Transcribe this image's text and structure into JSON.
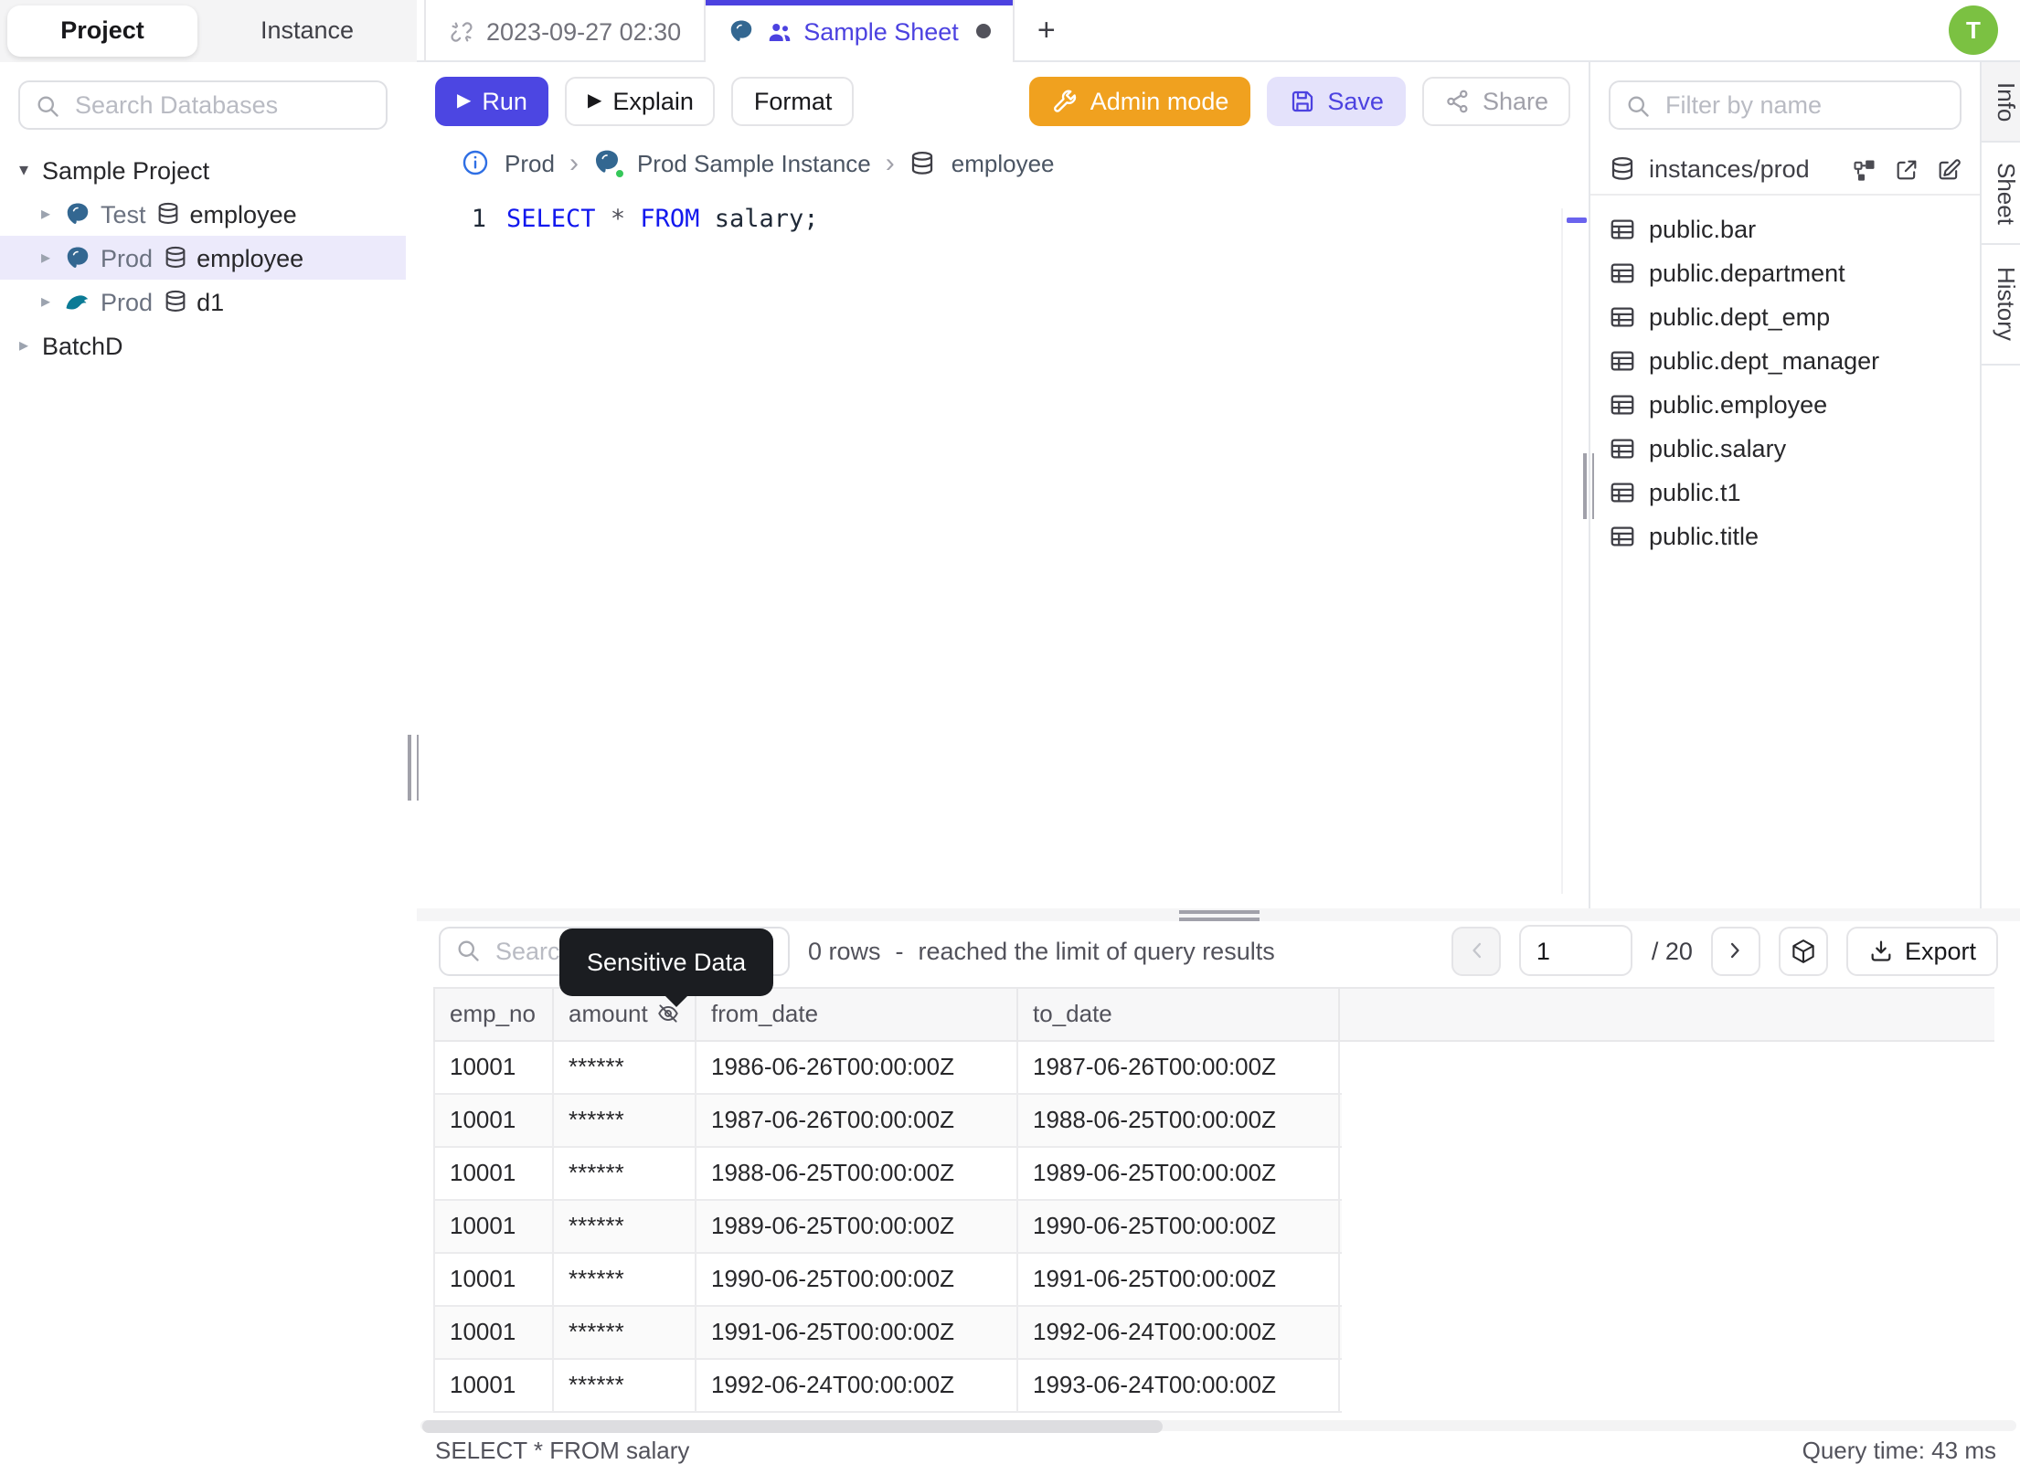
{
  "colors": {
    "accent": "#4c42e0",
    "admin_orange": "#f0a11f",
    "save_bg": "#e4e2fb",
    "avatar_green": "#7bc142",
    "keyword_blue": "#1218ee",
    "selected_tree_bg": "#eceafb",
    "tooltip_bg": "#1b1d21"
  },
  "topbar": {
    "project_tab": "Project",
    "instance_tab": "Instance",
    "editor_tabs": [
      {
        "label": "2023-09-27 02:30"
      },
      {
        "label": "Sample Sheet"
      }
    ],
    "new_tab_label": "+",
    "avatar_initial": "T"
  },
  "sidebar": {
    "search_placeholder": "Search Databases",
    "tree": [
      {
        "label": "Sample Project"
      },
      {
        "env": "Test",
        "db": "employee"
      },
      {
        "env": "Prod",
        "db": "employee"
      },
      {
        "env": "Prod",
        "db": "d1"
      },
      {
        "label": "BatchD"
      }
    ]
  },
  "toolbar": {
    "run": "Run",
    "explain": "Explain",
    "format": "Format",
    "admin_mode": "Admin mode",
    "save": "Save",
    "share": "Share"
  },
  "breadcrumb": {
    "env": "Prod",
    "instance": "Prod Sample Instance",
    "database": "employee"
  },
  "editor": {
    "line_number": "1",
    "sql": {
      "kw1": "SELECT",
      "star": "*",
      "kw2": "FROM",
      "rest": " salary;"
    }
  },
  "right_panel": {
    "filter_placeholder": "Filter by name",
    "header": "instances/prod",
    "tables": [
      "public.bar",
      "public.department",
      "public.dept_emp",
      "public.dept_manager",
      "public.employee",
      "public.salary",
      "public.t1",
      "public.title"
    ]
  },
  "side_tabs": {
    "info": "Info",
    "sheet": "Sheet",
    "history": "History"
  },
  "results": {
    "search_placeholder": "Search",
    "tooltip": "Sensitive Data",
    "row_count_fragment": "0 rows",
    "dash": "-",
    "limit_note": "reached the limit of query results",
    "page": {
      "current": "1",
      "total": "/ 20"
    },
    "export_label": "Export",
    "table": {
      "columns": [
        "emp_no",
        "amount",
        "from_date",
        "to_date"
      ],
      "masked_column": "amount",
      "rows": [
        {
          "emp_no": "10001",
          "amount": "******",
          "from_date": "1986-06-26T00:00:00Z",
          "to_date": "1987-06-26T00:00:00Z"
        },
        {
          "emp_no": "10001",
          "amount": "******",
          "from_date": "1987-06-26T00:00:00Z",
          "to_date": "1988-06-25T00:00:00Z"
        },
        {
          "emp_no": "10001",
          "amount": "******",
          "from_date": "1988-06-25T00:00:00Z",
          "to_date": "1989-06-25T00:00:00Z"
        },
        {
          "emp_no": "10001",
          "amount": "******",
          "from_date": "1989-06-25T00:00:00Z",
          "to_date": "1990-06-25T00:00:00Z"
        },
        {
          "emp_no": "10001",
          "amount": "******",
          "from_date": "1990-06-25T00:00:00Z",
          "to_date": "1991-06-25T00:00:00Z"
        },
        {
          "emp_no": "10001",
          "amount": "******",
          "from_date": "1991-06-25T00:00:00Z",
          "to_date": "1992-06-24T00:00:00Z"
        },
        {
          "emp_no": "10001",
          "amount": "******",
          "from_date": "1992-06-24T00:00:00Z",
          "to_date": "1993-06-24T00:00:00Z"
        }
      ]
    },
    "status": {
      "statement": "SELECT * FROM salary",
      "query_time": "Query time: 43 ms"
    }
  }
}
